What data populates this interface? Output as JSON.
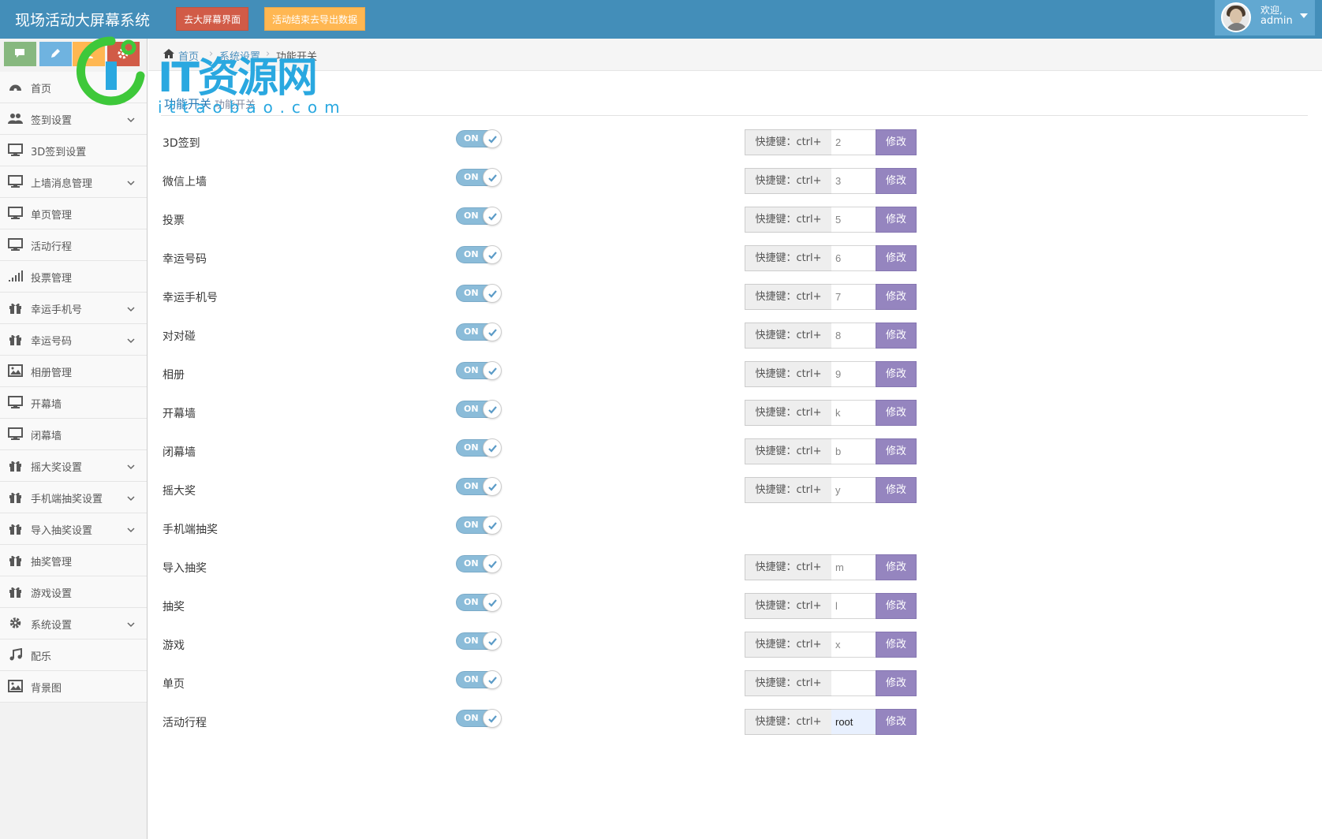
{
  "navbar": {
    "brand": "现场活动大屏幕系统",
    "btn_screen": "去大屏幕界面",
    "btn_export": "活动结束去导出数据",
    "welcome": "欢迎,",
    "username": "admin"
  },
  "colors": {
    "navbar": "#438eb9",
    "btn_red": "#d15b47",
    "btn_orange": "#ffb752",
    "toggle_on": "#8bbcd9",
    "submit_button": "#9585bf"
  },
  "sidebar": {
    "items": [
      {
        "label": "首页",
        "icon": "dashboard-icon",
        "arrow": false
      },
      {
        "label": "签到设置",
        "icon": "users-icon",
        "arrow": true
      },
      {
        "label": "3D签到设置",
        "icon": "desktop-icon",
        "arrow": false
      },
      {
        "label": "上墙消息管理",
        "icon": "desktop-icon",
        "arrow": true
      },
      {
        "label": "单页管理",
        "icon": "desktop-icon",
        "arrow": false
      },
      {
        "label": "活动行程",
        "icon": "desktop-icon",
        "arrow": false
      },
      {
        "label": "投票管理",
        "icon": "signal-icon",
        "arrow": false
      },
      {
        "label": "幸运手机号",
        "icon": "gift-icon",
        "arrow": true
      },
      {
        "label": "幸运号码",
        "icon": "gift-icon",
        "arrow": true
      },
      {
        "label": "相册管理",
        "icon": "picture-icon",
        "arrow": false
      },
      {
        "label": "开幕墙",
        "icon": "desktop-icon",
        "arrow": false
      },
      {
        "label": "闭幕墙",
        "icon": "desktop-icon",
        "arrow": false
      },
      {
        "label": "摇大奖设置",
        "icon": "gift-icon",
        "arrow": true
      },
      {
        "label": "手机端抽奖设置",
        "icon": "gift-icon",
        "arrow": true
      },
      {
        "label": "导入抽奖设置",
        "icon": "gift-icon",
        "arrow": true
      },
      {
        "label": "抽奖管理",
        "icon": "gift-icon",
        "arrow": false
      },
      {
        "label": "游戏设置",
        "icon": "gift-icon",
        "arrow": false
      },
      {
        "label": "系统设置",
        "icon": "gear-icon",
        "arrow": true
      },
      {
        "label": "配乐",
        "icon": "music-icon",
        "arrow": false
      },
      {
        "label": "背景图",
        "icon": "picture-icon",
        "arrow": false
      }
    ]
  },
  "breadcrumb": {
    "home": "首页",
    "section": "系统设置",
    "current": "功能开关"
  },
  "watermark": {
    "text": "IT资源网",
    "sub": "ittaobao.com"
  },
  "page": {
    "title": "功能开关",
    "subtitle": "功能开关"
  },
  "hotkey_prefix": "快捷键：ctrl+",
  "submit_label": "修改",
  "toggle_label": "ON",
  "features": [
    {
      "label": "3D签到",
      "hotkey": "2"
    },
    {
      "label": "微信上墙",
      "hotkey": "3"
    },
    {
      "label": "投票",
      "hotkey": "5"
    },
    {
      "label": "幸运号码",
      "hotkey": "6"
    },
    {
      "label": "幸运手机号",
      "hotkey": "7"
    },
    {
      "label": "对对碰",
      "hotkey": "8"
    },
    {
      "label": "相册",
      "hotkey": "9"
    },
    {
      "label": "开幕墙",
      "hotkey": "k"
    },
    {
      "label": "闭幕墙",
      "hotkey": "b"
    },
    {
      "label": "摇大奖",
      "hotkey": "y"
    },
    {
      "label": "手机端抽奖",
      "hotkey": null
    },
    {
      "label": "导入抽奖",
      "hotkey": "m"
    },
    {
      "label": "抽奖",
      "hotkey": "l"
    },
    {
      "label": "游戏",
      "hotkey": "x"
    },
    {
      "label": "单页",
      "hotkey": ""
    },
    {
      "label": "活动行程",
      "hotkey": "root"
    }
  ]
}
